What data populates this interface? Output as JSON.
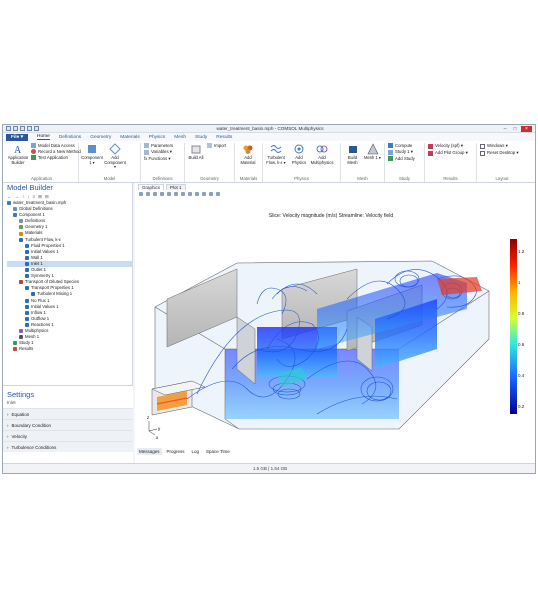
{
  "window": {
    "title": "water_treatment_basin.mph - COMSOL Multiphysics"
  },
  "tabs": [
    "File ▾",
    "Home",
    "Definitions",
    "Geometry",
    "Materials",
    "Physics",
    "Mesh",
    "Study",
    "Results"
  ],
  "ribbon": {
    "application": {
      "builder": "Application Builder",
      "items": [
        "Model Data Access",
        "Record a New Method",
        "Test Application"
      ],
      "label": "Application"
    },
    "model": {
      "component": "Component 1 ▾",
      "add_component": "Add Component ▾",
      "label": "Model"
    },
    "definitions": {
      "items": [
        "Parameters",
        "Variables ▾",
        "fx Functions ▾"
      ],
      "label": "Definitions"
    },
    "geometry": {
      "build": "Build All",
      "import": "Import",
      "label": "Geometry"
    },
    "materials": {
      "add": "Add Material",
      "label": "Materials"
    },
    "physics": {
      "turbulent": "Turbulent Flow, k-ε ▾",
      "add_physics": "Add Physics",
      "add_multiphysics": "Add Multiphysics",
      "label": "Physics"
    },
    "mesh": {
      "build": "Build Mesh",
      "mesh1": "Mesh 1 ▾",
      "label": "Mesh"
    },
    "study": {
      "items": [
        "Compute",
        "Study 1 ▾",
        "Add Study"
      ],
      "label": "Study"
    },
    "results": {
      "items": [
        "Velocity (spf) ▾",
        "Add Plot Group ▾"
      ],
      "label": "Results"
    },
    "layout": {
      "items": [
        "Windows ▾",
        "Reset Desktop ▾"
      ],
      "label": "Layout"
    }
  },
  "model_builder": {
    "title": "Model Builder",
    "tree": [
      {
        "text": "water_treatment_basin.mph",
        "depth": 0,
        "color": "#3c78c3"
      },
      {
        "text": "Global Definitions",
        "depth": 1,
        "color": "#6b8fb8"
      },
      {
        "text": "Component 1",
        "depth": 1,
        "color": "#3c78c3"
      },
      {
        "text": "Definitions",
        "depth": 2,
        "color": "#7c8fa8"
      },
      {
        "text": "Geometry 1",
        "depth": 2,
        "color": "#6a9a4e"
      },
      {
        "text": "Materials",
        "depth": 2,
        "color": "#d08a2a"
      },
      {
        "text": "Turbulent Flow, k-ε",
        "depth": 2,
        "color": "#2d6db5"
      },
      {
        "text": "Fluid Properties 1",
        "depth": 3,
        "color": "#2d6db5"
      },
      {
        "text": "Initial Values 1",
        "depth": 3,
        "color": "#2d6db5"
      },
      {
        "text": "Wall 1",
        "depth": 3,
        "color": "#2d6db5"
      },
      {
        "text": "Inlet 1",
        "depth": 3,
        "color": "#2d6db5",
        "selected": true
      },
      {
        "text": "Outlet 1",
        "depth": 3,
        "color": "#2d6db5"
      },
      {
        "text": "Symmetry 1",
        "depth": 3,
        "color": "#2d6db5"
      },
      {
        "text": "Transport of Diluted Species",
        "depth": 2,
        "color": "#b5452d"
      },
      {
        "text": "Transport Properties 1",
        "depth": 3,
        "color": "#2d6db5"
      },
      {
        "text": "Turbulent Mixing 1",
        "depth": 4,
        "color": "#2d6db5"
      },
      {
        "text": "No Flux 1",
        "depth": 3,
        "color": "#2d6db5"
      },
      {
        "text": "Initial Values 1",
        "depth": 3,
        "color": "#2d6db5"
      },
      {
        "text": "Inflow 1",
        "depth": 3,
        "color": "#2d6db5"
      },
      {
        "text": "Outflow 1",
        "depth": 3,
        "color": "#2d6db5"
      },
      {
        "text": "Reactions 1",
        "depth": 3,
        "color": "#2d6db5"
      },
      {
        "text": "Multiphysics",
        "depth": 2,
        "color": "#8a5fb0"
      },
      {
        "text": "Mesh 1",
        "depth": 2,
        "color": "#555"
      },
      {
        "text": "Study 1",
        "depth": 1,
        "color": "#3c9a5a"
      },
      {
        "text": "Results",
        "depth": 1,
        "color": "#c44"
      }
    ]
  },
  "settings": {
    "title": "Settings",
    "subtitle": "Inlet",
    "sections": [
      "Equation",
      "Boundary Condition",
      "Velocity",
      "Turbulence Conditions"
    ]
  },
  "graphics": {
    "tabs": [
      "Graphics",
      "Plot 1"
    ],
    "plot_title": "Slice: Velocity magnitude (m/s)  Streamline: Velocity field",
    "colorbar": {
      "labels": [
        "1.2",
        "1",
        "0.8",
        "0.6",
        "0.4",
        "0.2"
      ]
    },
    "axes": {
      "x": "x",
      "y": "y",
      "z": "z"
    },
    "bottom_tabs": [
      "Messages",
      "Progress",
      "Log",
      "Space Time"
    ]
  },
  "status": {
    "memory": "1.5 GB | 1.54 GB"
  }
}
